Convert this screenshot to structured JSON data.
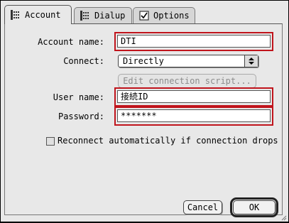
{
  "tabs": [
    {
      "label": "Account",
      "icon": "account-icon",
      "active": true
    },
    {
      "label": "Dialup",
      "icon": "dialup-icon",
      "active": false
    },
    {
      "label": "Options",
      "icon": "checkbox-icon",
      "active": false
    }
  ],
  "form": {
    "account_name_label": "Account name:",
    "account_name_value": "DTI",
    "connect_label": "Connect:",
    "connect_value": "Directly",
    "edit_script_label": "Edit connection script...",
    "user_name_label": "User name:",
    "user_name_value": "接続ID",
    "password_label": "Password:",
    "password_value": "*******",
    "reconnect_label": "Reconnect automatically if connection drops",
    "reconnect_checked": false
  },
  "buttons": {
    "cancel_label": "Cancel",
    "ok_label": "OK"
  },
  "colors": {
    "highlight": "#c0141c",
    "window_bg": "#e8e8e8"
  }
}
